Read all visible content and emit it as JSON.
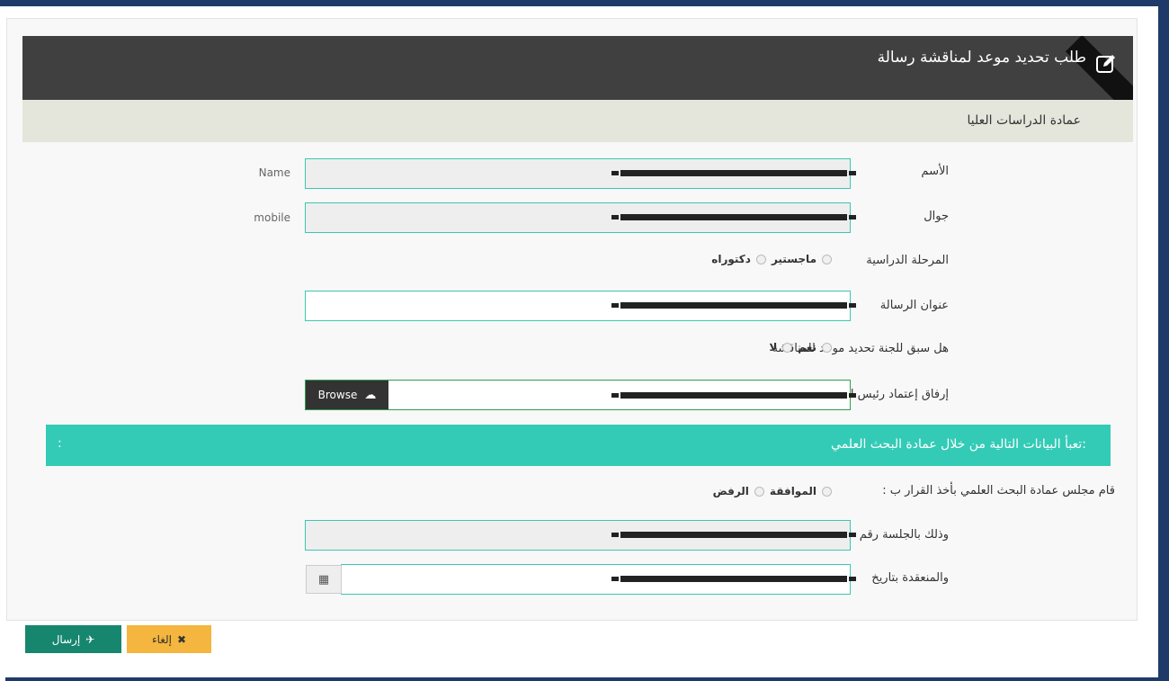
{
  "header": {
    "title": "طلب تحديد موعد لمناقشة رسالة",
    "icon": "edit-icon"
  },
  "subheader": {
    "title": "عمادة الدراسات العليا"
  },
  "fields": {
    "name": {
      "label": "الأسم",
      "en_label": "Name"
    },
    "mobile": {
      "label": "جوال",
      "en_label": "mobile"
    },
    "stage": {
      "label": "المرحلة الدراسية",
      "options": [
        "ماجستير",
        "دكتوراه"
      ]
    },
    "thesis_title": {
      "label": "عنوان الرسالة"
    },
    "prior_committee": {
      "label": "هل سبق للجنة تحديد موعد للمناقشة",
      "options": [
        "نعم",
        "لا"
      ]
    },
    "attachment": {
      "label": "إرفاق إعتماد رئيس القسم وعميد الكلية",
      "browse_label": "Browse"
    }
  },
  "research_section": {
    "title": "تعبأ البيانات التالية من خلال عمادة البحث العلمي:",
    "colon": ":",
    "decision": {
      "label": "قام مجلس عمادة البحث العلمي بأخذ القرار ب :",
      "options": [
        "الموافقة",
        "الرفض"
      ]
    },
    "session_number": {
      "label": "وذلك بالجلسة رقم"
    },
    "session_date": {
      "label": "والمنعقدة بتاريخ",
      "icon": "calendar-icon"
    }
  },
  "actions": {
    "send_label": "إرسال",
    "cancel_label": "إلغاء"
  },
  "colors": {
    "header": "#404040",
    "subheader": "#e4e6dc",
    "teal": "#33cbb6",
    "send": "#17866f",
    "cancel": "#f4b63e",
    "frame": "#1f3a68"
  }
}
